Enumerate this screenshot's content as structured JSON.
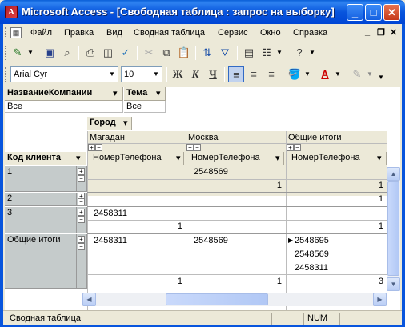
{
  "window": {
    "title": "Microsoft Access - [Свободная таблица : запрос на выборку]",
    "app_icon_letter": "A",
    "min_glyph": "_",
    "max_glyph": "□",
    "close_glyph": "✕",
    "mdi_min": "_",
    "mdi_restore": "❐",
    "mdi_close": "✕"
  },
  "menu": [
    "Файл",
    "Правка",
    "Вид",
    "Сводная таблица",
    "Сервис",
    "Окно",
    "Справка"
  ],
  "toolbar2": {
    "font_name": "Arial Cyr",
    "font_size": "10",
    "bold": "Ж",
    "italic": "К",
    "underline": "Ч"
  },
  "filters": [
    {
      "field": "НазваниеКомпании",
      "value": "Все"
    },
    {
      "field": "Тема",
      "value": "Все"
    }
  ],
  "column_field": "Город",
  "row_field": "Код клиента",
  "columns": [
    {
      "name": "Магадан",
      "data_field": "НомерТелефона"
    },
    {
      "name": "Москва",
      "data_field": "НомерТелефона"
    },
    {
      "name": "Общие итоги",
      "data_field": "НомерТелефона"
    }
  ],
  "rows": [
    {
      "key": "1",
      "magadan": [
        ""
      ],
      "moskva": [
        "2548569"
      ],
      "total": [
        ""
      ],
      "counts": [
        "",
        "1",
        "1"
      ]
    },
    {
      "key": "2",
      "magadan": [
        ""
      ],
      "moskva": [
        ""
      ],
      "total": [
        ""
      ],
      "counts": [
        "",
        "",
        "1"
      ]
    },
    {
      "key": "3",
      "magadan": [
        "2458311"
      ],
      "moskva": [
        ""
      ],
      "total": [
        ""
      ],
      "counts": [
        "1",
        "",
        "1"
      ]
    },
    {
      "key": "Общие итоги",
      "magadan": [
        "2458311"
      ],
      "moskva": [
        "2548569"
      ],
      "total": [
        "2548695",
        "2548569",
        "2458311"
      ],
      "counts": [
        "1",
        "1",
        "3"
      ]
    }
  ],
  "expand_glyphs": {
    "plus": "+",
    "minus": "−"
  },
  "dropdown_glyph": "▾",
  "status": {
    "text": "Сводная таблица",
    "num": "NUM"
  }
}
